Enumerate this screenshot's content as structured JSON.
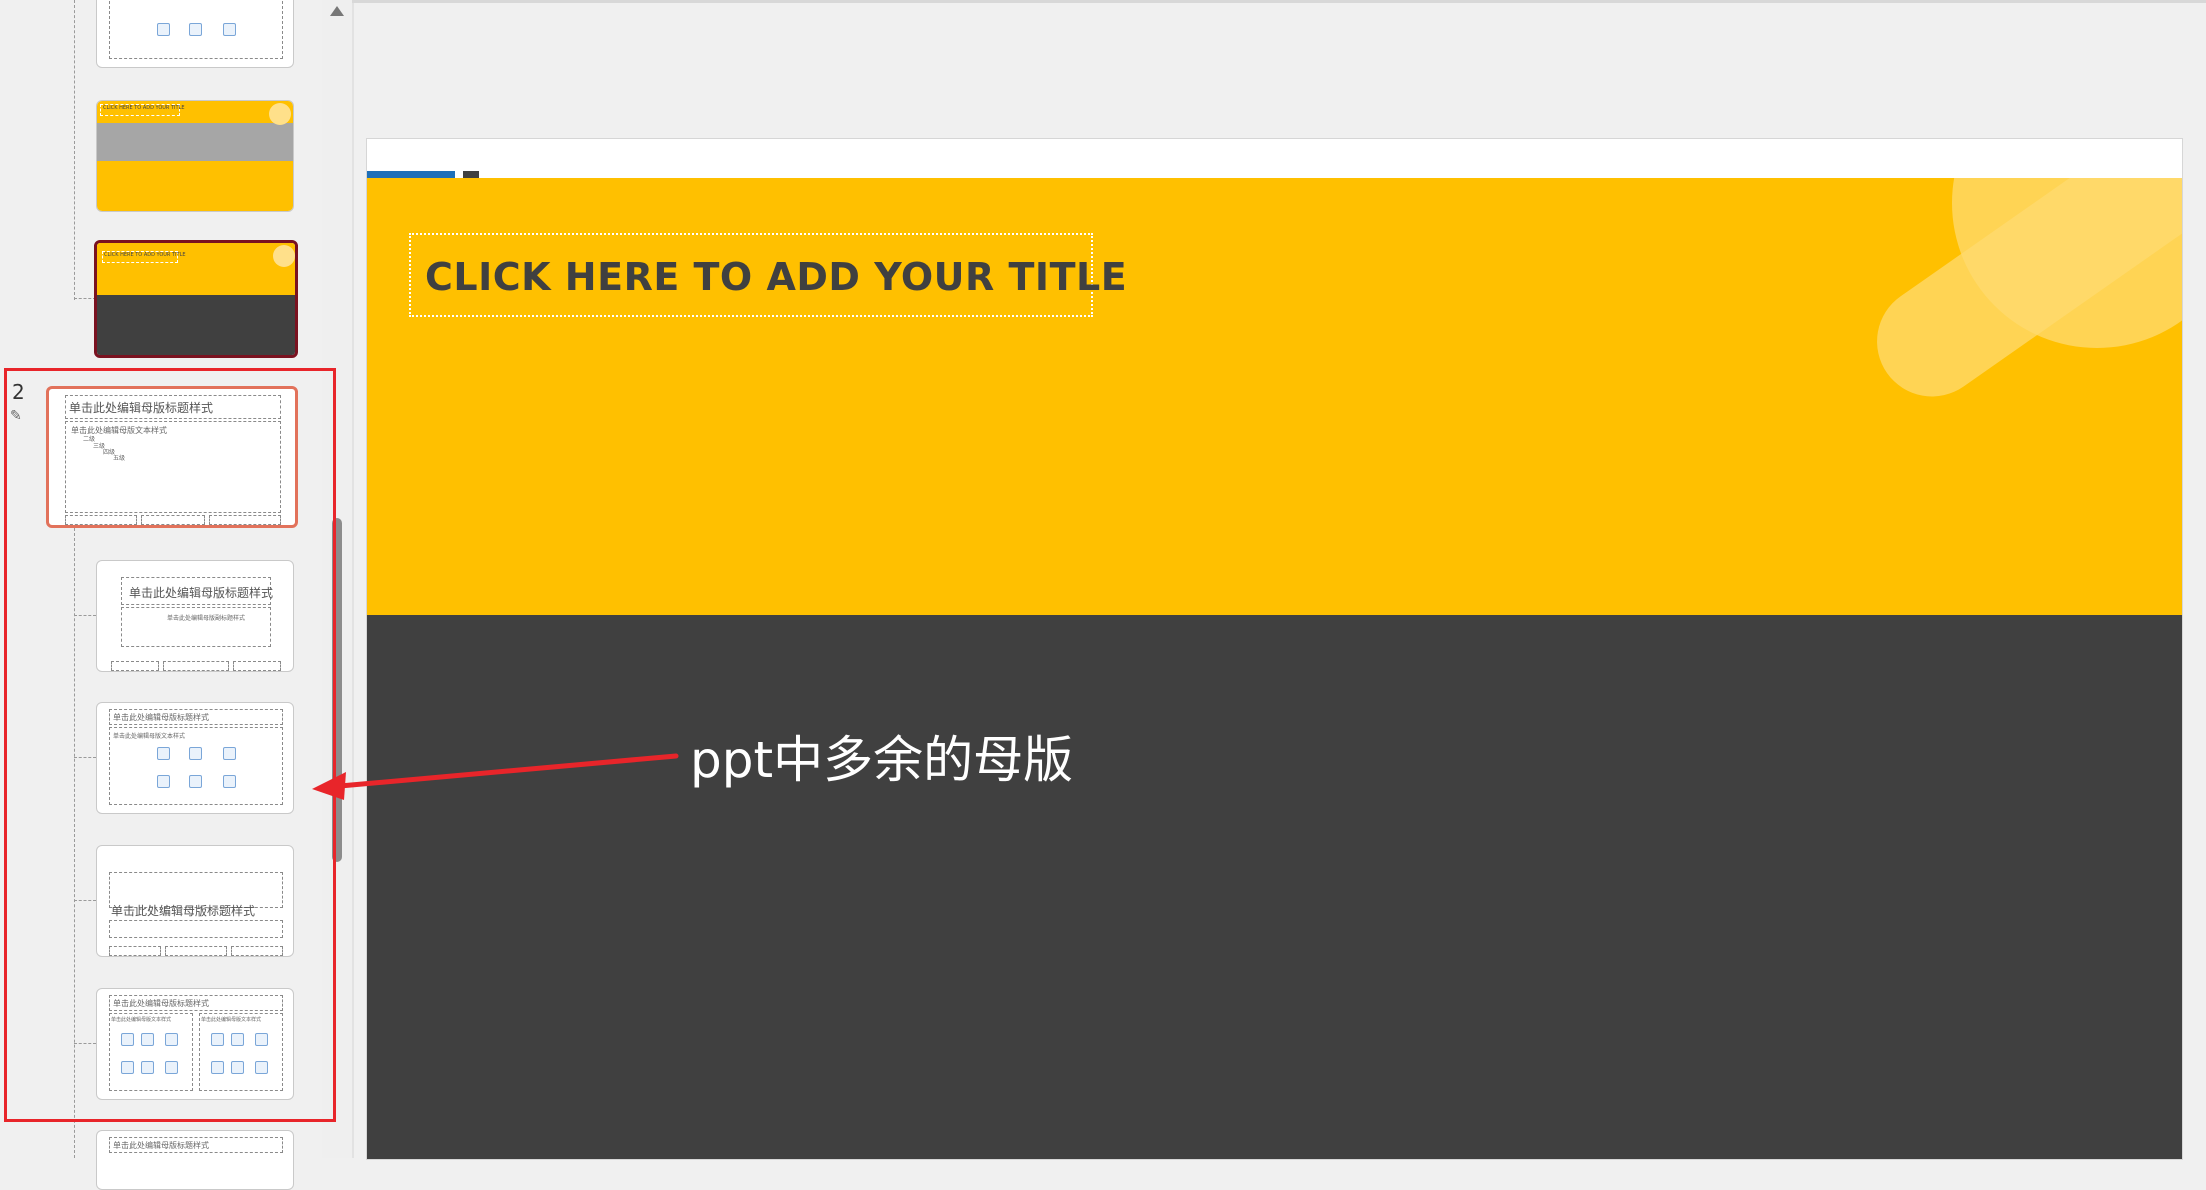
{
  "panel": {
    "slide_number": "2",
    "pin_icon": "pin-icon",
    "master_title_placeholder": "单击此处编辑母版标题样式",
    "master_text_placeholder": "单击此处编辑母版文本样式",
    "master_levels": [
      "二级",
      "三级",
      "四级",
      "五级"
    ],
    "layout_title_placeholder": "单击此处编辑母版标题样式",
    "layout_subtitle_placeholder": "单击此处编辑母版副标题样式",
    "layout_text_placeholder": "单击此处编辑母版文本样式",
    "thumb_title_small": "CLICK HERE TO ADD YOUR TITLE"
  },
  "slide": {
    "title": "CLICK HERE TO ADD YOUR TITLE",
    "colors": {
      "yellow": "#ffc000",
      "dark": "#404040",
      "blue": "#1f6fb8"
    }
  },
  "annotation": {
    "text": "ppt中多余的母版",
    "color": "#e8252a"
  }
}
